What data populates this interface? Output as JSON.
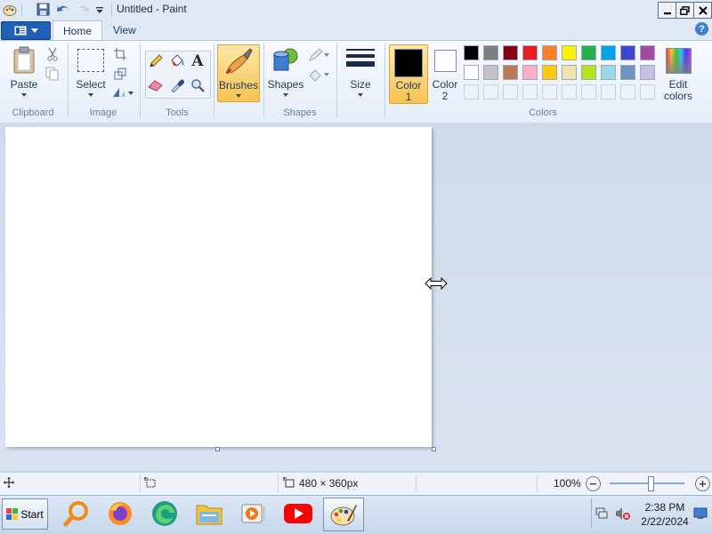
{
  "window": {
    "title": "Untitled - Paint"
  },
  "tabs": [
    {
      "label": "Home"
    },
    {
      "label": "View"
    }
  ],
  "ribbon": {
    "clipboard": {
      "paste_label": "Paste",
      "group_label": "Clipboard"
    },
    "image": {
      "select_label": "Select",
      "group_label": "Image"
    },
    "tools": {
      "group_label": "Tools",
      "text_tool_glyph": "A"
    },
    "brushes": {
      "label": "Brushes"
    },
    "shapes": {
      "label": "Shapes",
      "group_label": "Shapes"
    },
    "size": {
      "label": "Size"
    },
    "color1": {
      "label_line1": "Color",
      "label_line2": "1",
      "color": "#000000"
    },
    "color2": {
      "label_line1": "Color",
      "label_line2": "2",
      "color": "#ffffff"
    },
    "colors": {
      "group_label": "Colors",
      "edit_label_line1": "Edit",
      "edit_label_line2": "colors",
      "palette_row1": [
        "#000000",
        "#7f7f7f",
        "#880015",
        "#ed1c24",
        "#ff7f27",
        "#fff200",
        "#22b14c",
        "#00a2e8",
        "#3f48cc",
        "#a349a4"
      ],
      "palette_row2": [
        "#ffffff",
        "#c3c3c3",
        "#b97a57",
        "#ffaec9",
        "#ffc90e",
        "#efe4b0",
        "#b5e61d",
        "#99d9ea",
        "#7092be",
        "#c8bfe7"
      ],
      "palette_row3_count": 10
    }
  },
  "statusbar": {
    "image_size": "480 × 360px",
    "zoom": "100%"
  },
  "taskbar": {
    "start_label": "Start",
    "time": "2:38 PM",
    "date": "2/22/2024"
  }
}
